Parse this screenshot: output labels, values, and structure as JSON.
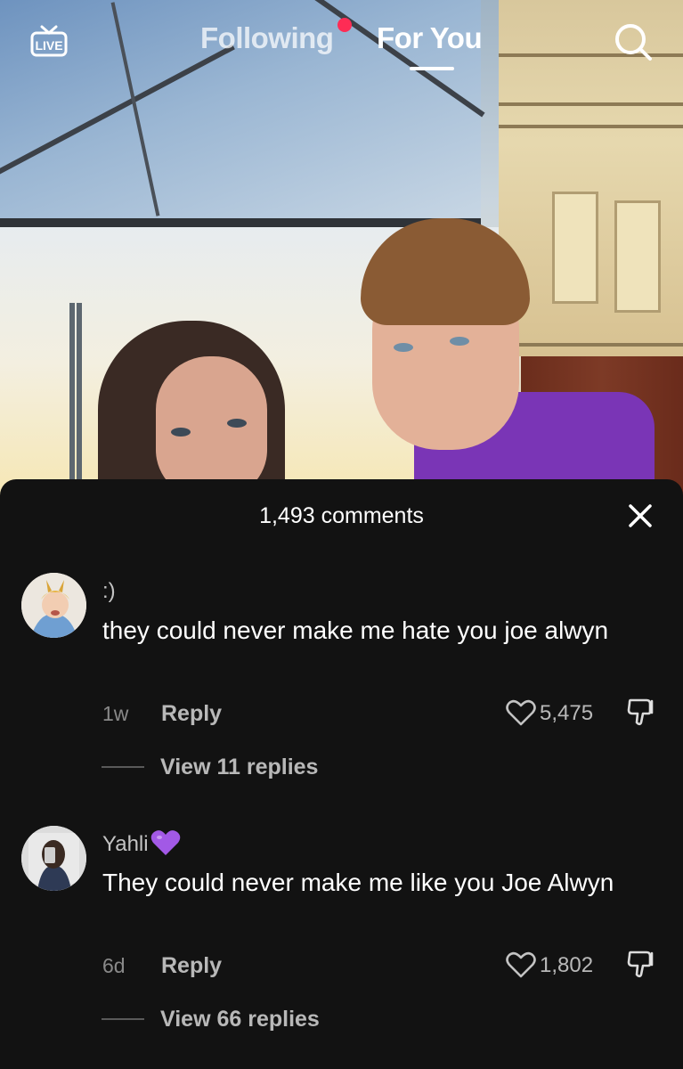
{
  "nav": {
    "live_label": "LIVE",
    "tabs": [
      {
        "label": "Following",
        "has_notification_dot": true,
        "active": false
      },
      {
        "label": "For You",
        "active": true
      }
    ],
    "icons": [
      "live-icon",
      "search-icon"
    ],
    "notification_dot_color": "#fe2c55"
  },
  "comments_panel": {
    "title": "1,493 comments",
    "close_icon": "close-icon",
    "comments": [
      {
        "username": ":)",
        "text": "they could never make me hate you joe alwyn",
        "time": "1w",
        "reply_label": "Reply",
        "likes": "5,475",
        "view_replies": "View 11 replies"
      },
      {
        "username": "Yahli",
        "username_emoji": "purple-heart-emoji",
        "text": "They could never make me like you Joe Alwyn",
        "time": "6d",
        "reply_label": "Reply",
        "likes": "1,802",
        "view_replies": "View 66 replies"
      }
    ]
  },
  "colors": {
    "sheet_background": "#121212",
    "accent_red": "#fe2c55",
    "emoji_purple": "#a259e6"
  }
}
